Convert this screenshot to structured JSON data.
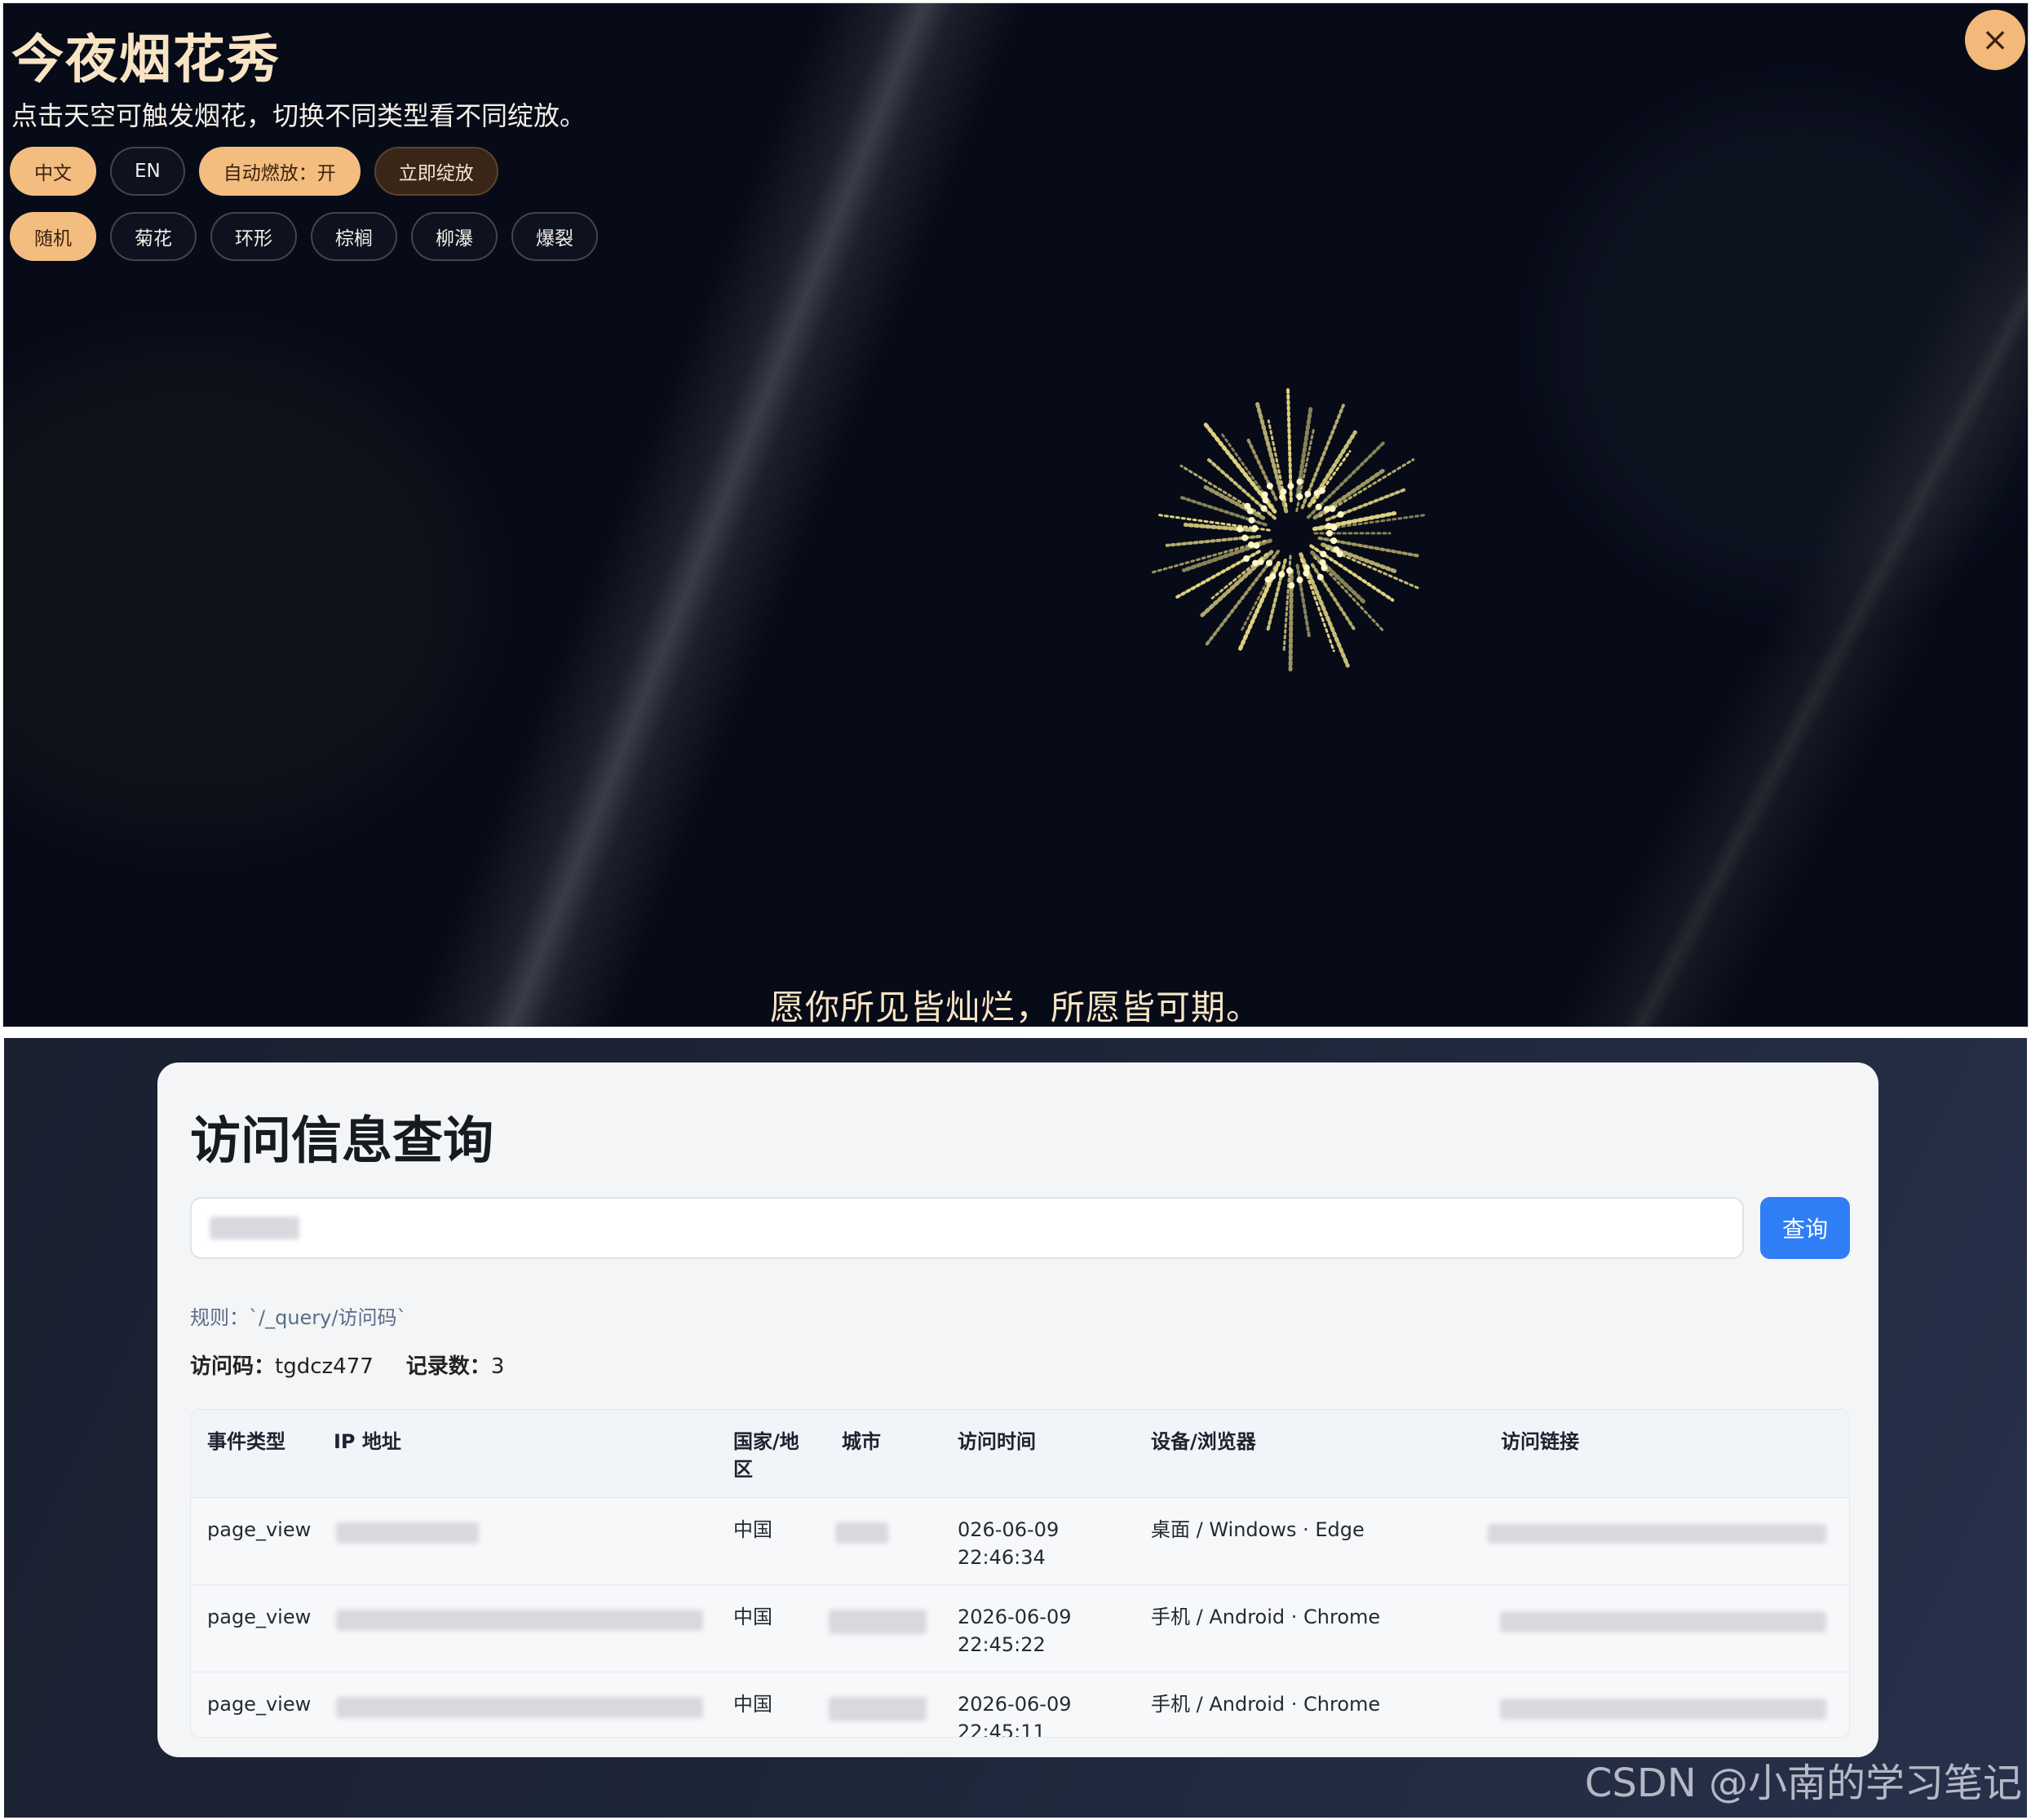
{
  "fireworks": {
    "title": "今夜烟花秀",
    "subtitle": "点击天空可触发烟花，切换不同类型看不同绽放。",
    "controls": [
      {
        "label": "中文",
        "state": "on"
      },
      {
        "label": "EN",
        "state": "off"
      },
      {
        "label": "自动燃放：开",
        "state": "on"
      },
      {
        "label": "立即绽放",
        "state": "burst"
      }
    ],
    "types": [
      {
        "label": "随机",
        "state": "on"
      },
      {
        "label": "菊花",
        "state": "off"
      },
      {
        "label": "环形",
        "state": "off"
      },
      {
        "label": "棕榈",
        "state": "off"
      },
      {
        "label": "柳瀑",
        "state": "off"
      },
      {
        "label": "爆裂",
        "state": "off"
      }
    ],
    "close_icon": "×",
    "footer": "愿你所见皆灿烂，所愿皆可期。"
  },
  "query": {
    "title": "访问信息查询",
    "search_button": "查询",
    "rule": "规则：`/_query/访问码`",
    "code_label": "访问码：",
    "code_value": "tgdcz477",
    "count_label": "记录数：",
    "count_value": "3",
    "columns": [
      "事件类型",
      "IP 地址",
      "国家/地\n区",
      "城市",
      "访问时间",
      "设备/浏览器",
      "访问链接"
    ],
    "rows": [
      {
        "event": "page_view",
        "country": "中国",
        "time": "026-06-09\n22:46:34",
        "device": "桌面 / Windows · Edge"
      },
      {
        "event": "page_view",
        "country": "中国",
        "time": "2026-06-09\n22:45:22",
        "device": "手机 / Android · Chrome"
      },
      {
        "event": "page_view",
        "country": "中国",
        "time": "2026-06-09\n22:45:11",
        "device": "手机 / Android · Chrome"
      }
    ]
  },
  "watermark": "CSDN @小南的学习笔记",
  "colors": {
    "sky": "#070b18",
    "accent": "#f4bd80",
    "title_text": "#f8e4c4",
    "firework": "#f3e58a",
    "query_button": "#2f7ef5"
  }
}
